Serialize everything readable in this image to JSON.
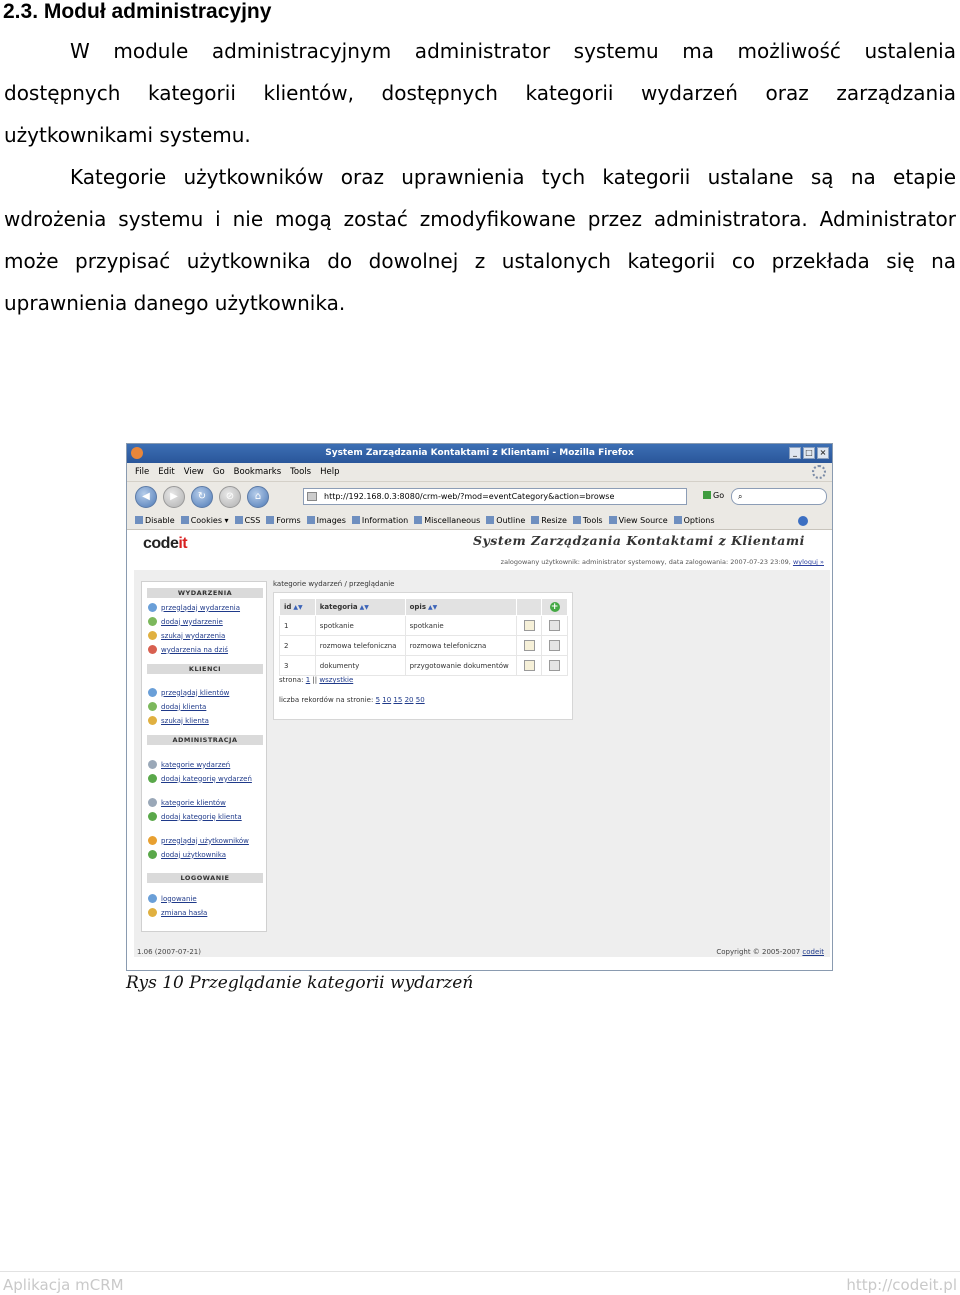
{
  "document": {
    "heading": "2.3. Moduł administracyjny",
    "paragraph1": "W module administracyjnym administrator systemu ma możliwość ustalenia dostępnych kategorii klientów, dostępnych kategorii wydarzeń oraz zarządzania użytkownikami systemu.",
    "paragraph2": "Kategorie użytkowników oraz uprawnienia tych kategorii ustalane są na etapie wdrożenia systemu i nie mogą zostać zmodyfikowane przez administratora. Administrator może przypisać użytkownika do dowolnej z ustalonych kategorii co przekłada się na uprawnienia danego użytkownika.",
    "caption": "Rys 10 Przeglądanie kategorii wydarzeń",
    "footer_left": "Aplikacja mCRM",
    "footer_right": "http://codeit.pl"
  },
  "browser": {
    "title": "System Zarządzania Kontaktami z Klientami - Mozilla Firefox",
    "menu": [
      "File",
      "Edit",
      "View",
      "Go",
      "Bookmarks",
      "Tools",
      "Help"
    ],
    "url": "http://192.168.0.3:8080/crm-web/?mod=eventCategory&action=browse",
    "go_label": "Go",
    "search_placeholder": "",
    "devbar": [
      "Disable",
      "Cookies ▾",
      "CSS",
      "Forms",
      "Images",
      "Information",
      "Miscellaneous",
      "Outline",
      "Resize",
      "Tools",
      "View Source",
      "Options"
    ]
  },
  "app": {
    "logo_prefix": "code",
    "logo_suffix": "it",
    "title": "System Zarządzania Kontaktami z Klientami",
    "login_info": "zalogowany użytkownik: administrator systemowy, data zalogowania: 2007-07-23 23:09,",
    "logout_label": "wyloguj »",
    "breadcrumb": "kategorie wydarzeń / przeglądanie",
    "sidebar": {
      "sections": [
        {
          "title": "WYDARZENIA",
          "items": [
            "przeglądaj wydarzenia",
            "dodaj wydarzenie",
            "szukaj wydarzenia",
            "wydarzenia na dziś"
          ]
        },
        {
          "title": "KLIENCI",
          "items": [
            "przeglądaj klientów",
            "dodaj klienta",
            "szukaj klienta"
          ]
        },
        {
          "title": "ADMINISTRACJA",
          "items": [
            "kategorie wydarzeń",
            "dodaj kategorię wydarzeń",
            "kategorie klientów",
            "dodaj kategorię klienta",
            "przeglądaj użytkowników",
            "dodaj użytkownika"
          ]
        },
        {
          "title": "LOGOWANIE",
          "items": [
            "logowanie",
            "zmiana hasła"
          ]
        }
      ]
    },
    "table": {
      "headers": [
        "id",
        "kategoria",
        "opis"
      ],
      "rows": [
        {
          "id": "1",
          "kategoria": "spotkanie",
          "opis": "spotkanie"
        },
        {
          "id": "2",
          "kategoria": "rozmowa telefoniczna",
          "opis": "rozmowa telefoniczna"
        },
        {
          "id": "3",
          "kategoria": "dokumenty",
          "opis": "przygotowanie dokumentów"
        }
      ]
    },
    "pager_label": "strona:",
    "pager_page": "1",
    "pager_all": "wszystkie",
    "limit_label": "liczba rekordów na stronie:",
    "limit_options": [
      "5",
      "10",
      "15",
      "20",
      "50"
    ],
    "version": "1.06 (2007-07-21)",
    "copyright": "Copyright © 2005-2007",
    "copyright_link": "codeit"
  },
  "colors": {
    "accent_red": "#d82222",
    "link_blue": "#1f3a8a",
    "titlebar_blue": "#3d6fb4"
  }
}
